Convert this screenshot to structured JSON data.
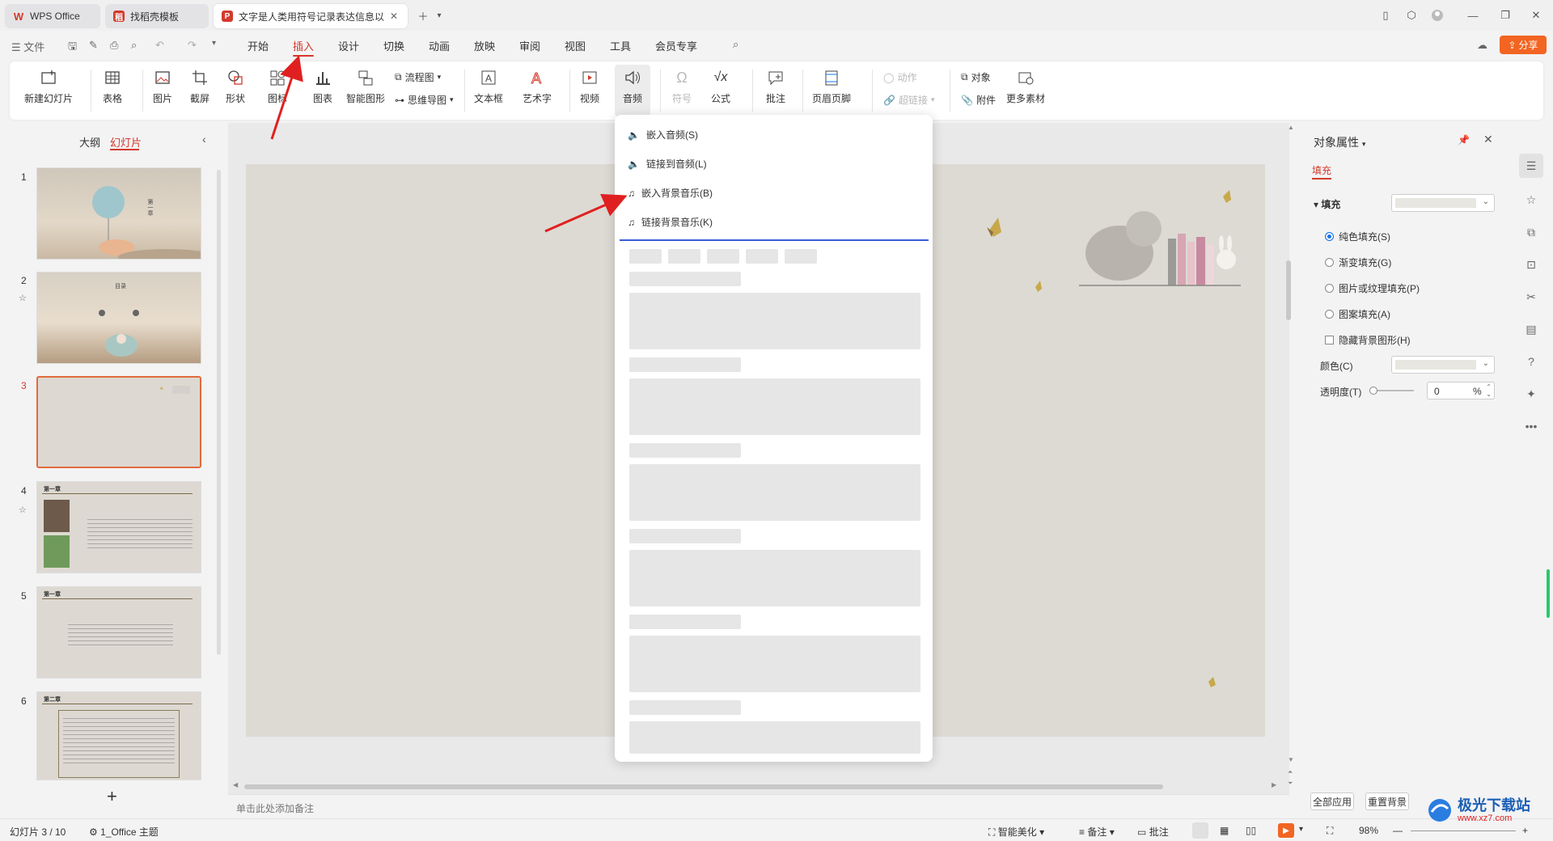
{
  "tabs": [
    {
      "label": "WPS Office",
      "state": "inactive"
    },
    {
      "label": "找稻壳模板",
      "state": "inactive"
    },
    {
      "label": "文字是人类用符号记录表达信息以",
      "state": "active"
    }
  ],
  "menu": {
    "file": "文件",
    "tabs": [
      "开始",
      "插入",
      "设计",
      "切换",
      "动画",
      "放映",
      "审阅",
      "视图",
      "工具",
      "会员专享"
    ],
    "active_tab": "插入",
    "share": "分享"
  },
  "ribbon": {
    "new_slide": "新建幻灯片",
    "table": "表格",
    "picture": "图片",
    "screenshot": "截屏",
    "shape": "形状",
    "icon": "图标",
    "chart": "图表",
    "smartart": "智能图形",
    "flowchart": "流程图",
    "mindmap": "思维导图",
    "textbox": "文本框",
    "wordart": "艺术字",
    "video": "视频",
    "audio": "音频",
    "symbol": "符号",
    "formula": "公式",
    "comment": "批注",
    "header_footer": "页眉页脚",
    "action": "动作",
    "hyperlink": "超链接",
    "object": "对象",
    "attachment": "附件",
    "more_material": "更多素材"
  },
  "left_panel": {
    "outline_tab": "大纲",
    "slides_tab": "幻灯片",
    "slides": [
      {
        "num": "1",
        "title": "第一章"
      },
      {
        "num": "2",
        "title": "目录"
      },
      {
        "num": "3",
        "title": ""
      },
      {
        "num": "4",
        "title": "第一章"
      },
      {
        "num": "5",
        "title": "第一章"
      },
      {
        "num": "6",
        "title": "第二章"
      }
    ],
    "add_slide": "+"
  },
  "audio_menu": {
    "items": [
      "嵌入音频(S)",
      "链接到音频(L)",
      "嵌入背景音乐(B)",
      "链接背景音乐(K)"
    ]
  },
  "notes_placeholder": "单击此处添加备注",
  "properties": {
    "title": "对象属性",
    "tab_fill": "填充",
    "fill_label": "填充",
    "options": [
      "纯色填充(S)",
      "渐变填充(G)",
      "图片或纹理填充(P)",
      "图案填充(A)"
    ],
    "selected_option": "纯色填充(S)",
    "hide_bg": "隐藏背景图形(H)",
    "color_label": "颜色(C)",
    "transparency_label": "透明度(T)",
    "transparency_value": "0",
    "percent": "%",
    "apply_all": "全部应用",
    "reset_bg": "重置背景"
  },
  "status": {
    "slide_info": "幻灯片 3 / 10",
    "theme": "1_Office 主题",
    "beautify": "智能美化",
    "notes": "备注",
    "comment": "批注",
    "zoom": "98%"
  },
  "watermark": {
    "text": "极光下载站",
    "url": "www.xz7.com"
  },
  "colors": {
    "accent": "#d33a2c",
    "share_bg": "#f26522",
    "blue": "#1a73e8",
    "arrow": "#e02020"
  }
}
